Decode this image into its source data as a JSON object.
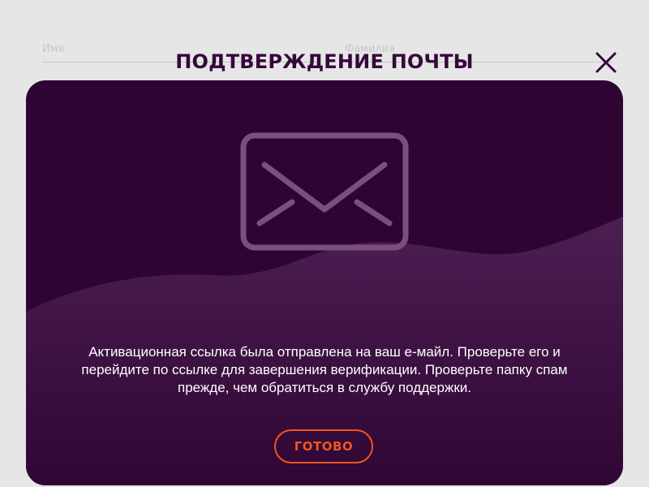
{
  "background_form": {
    "first_name_placeholder": "Имя",
    "last_name_placeholder": "Фамилия"
  },
  "modal": {
    "title": "ПОДТВЕРЖДЕНИЕ ПОЧТЫ",
    "close_icon": "close-icon",
    "illustration_icon": "envelope-icon",
    "message": "Активационная ссылка была отправлена на ваш е-майл. Проверьте его и перейдите по ссылке для завершения верификации. Проверьте папку спам прежде, чем обратиться в службу поддержки.",
    "done_label": "ГОТОВО"
  },
  "colors": {
    "page_background": "#e6e6e6",
    "title": "#35083a",
    "card_dark": "#2e0532",
    "card_wave": "#4a1e4f",
    "icon_stroke": "#7a4f80",
    "accent": "#f0561d",
    "text": "#ffffff"
  }
}
